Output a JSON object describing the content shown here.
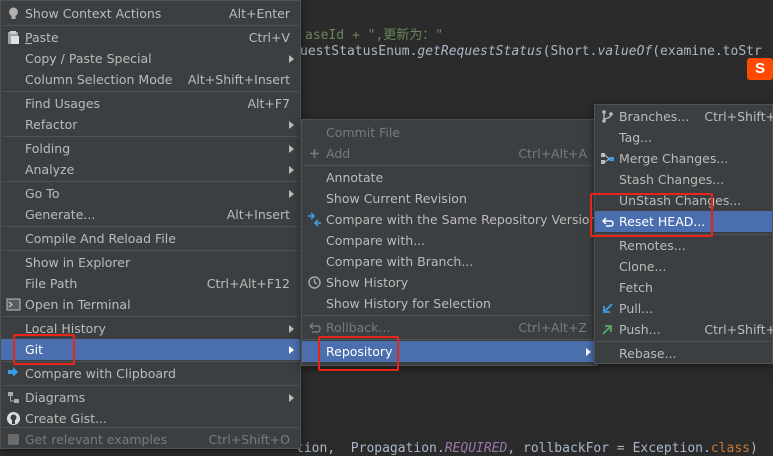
{
  "editor": {
    "line1": "aseId + \",更新为：\"",
    "line2a": "uestStatusEnum.",
    "line2b": "getRequestStatus",
    "line2c": "(Short.",
    "line2d": "valueOf",
    "line2e": "(examine.toStr",
    "line3a": "tion,  Propagation.",
    "line3b": "REQUIRED",
    "line3c": ", rollbackFor = Exception.",
    "line3d": "class",
    "line3e": ")"
  },
  "main_menu": {
    "items": [
      {
        "label": "Show Context Actions",
        "shortcut": "Alt+Enter",
        "icon": "bulb-icon"
      },
      {
        "label": "Paste",
        "shortcut": "Ctrl+V",
        "icon": "paste-icon"
      },
      {
        "label": "Copy / Paste Special",
        "shortcut": "",
        "submenu": true
      },
      {
        "label": "Column Selection Mode",
        "shortcut": "Alt+Shift+Insert"
      },
      {
        "label": "Find Usages",
        "shortcut": "Alt+F7"
      },
      {
        "label": "Refactor",
        "shortcut": "",
        "submenu": true
      },
      {
        "label": "Folding",
        "shortcut": "",
        "submenu": true
      },
      {
        "label": "Analyze",
        "shortcut": "",
        "submenu": true
      },
      {
        "label": "Go To",
        "shortcut": "",
        "submenu": true
      },
      {
        "label": "Generate...",
        "shortcut": "Alt+Insert"
      },
      {
        "label": "Compile And Reload File",
        "shortcut": ""
      },
      {
        "label": "Show in Explorer",
        "shortcut": ""
      },
      {
        "label": "File Path",
        "shortcut": "Ctrl+Alt+F12"
      },
      {
        "label": "Open in Terminal",
        "shortcut": "",
        "icon": "terminal-icon"
      },
      {
        "label": "Local History",
        "shortcut": "",
        "submenu": true
      },
      {
        "label": "Git",
        "shortcut": "",
        "submenu": true,
        "selected": true
      },
      {
        "label": "Compare with Clipboard",
        "shortcut": "",
        "icon": "compare-icon"
      },
      {
        "label": "Diagrams",
        "shortcut": "",
        "submenu": true,
        "icon": "diagram-icon"
      },
      {
        "label": "Create Gist...",
        "shortcut": "",
        "icon": "github-icon"
      },
      {
        "label": "Get relevant examples",
        "shortcut": "Ctrl+Shift+O",
        "disabled": true,
        "icon": "examples-icon"
      }
    ]
  },
  "git_menu": {
    "items": [
      {
        "label": "Commit File",
        "shortcut": "",
        "disabled": true
      },
      {
        "label": "Add",
        "shortcut": "Ctrl+Alt+A",
        "disabled": true,
        "icon": "plus-icon"
      },
      {
        "label": "Annotate",
        "shortcut": ""
      },
      {
        "label": "Show Current Revision",
        "shortcut": ""
      },
      {
        "label": "Compare with the Same Repository Version",
        "shortcut": "",
        "icon": "compare-arrows-icon"
      },
      {
        "label": "Compare with...",
        "shortcut": ""
      },
      {
        "label": "Compare with Branch...",
        "shortcut": ""
      },
      {
        "label": "Show History",
        "shortcut": "",
        "icon": "history-icon"
      },
      {
        "label": "Show History for Selection",
        "shortcut": ""
      },
      {
        "label": "Rollback...",
        "shortcut": "Ctrl+Alt+Z",
        "disabled": true,
        "icon": "rollback-icon"
      },
      {
        "label": "Repository",
        "shortcut": "",
        "submenu": true,
        "selected": true
      }
    ]
  },
  "repo_menu": {
    "items": [
      {
        "label": "Branches...",
        "shortcut": "Ctrl+Shift+",
        "icon": "branch-icon"
      },
      {
        "label": "Tag...",
        "shortcut": ""
      },
      {
        "label": "Merge Changes...",
        "shortcut": "",
        "icon": "merge-icon"
      },
      {
        "label": "Stash Changes...",
        "shortcut": ""
      },
      {
        "label": "UnStash Changes...",
        "shortcut": ""
      },
      {
        "label": "Reset HEAD...",
        "shortcut": "",
        "selected": true,
        "icon": "reset-icon"
      },
      {
        "label": "Remotes...",
        "shortcut": ""
      },
      {
        "label": "Clone...",
        "shortcut": ""
      },
      {
        "label": "Fetch",
        "shortcut": ""
      },
      {
        "label": "Pull...",
        "shortcut": "",
        "icon": "pull-icon"
      },
      {
        "label": "Push...",
        "shortcut": "Ctrl+Shift+",
        "icon": "push-icon"
      },
      {
        "label": "Rebase...",
        "shortcut": ""
      }
    ]
  },
  "colors": {
    "selection": "#4b6eaf",
    "menu_bg": "#3c3f41",
    "highlight_box": "#e8251a",
    "editor_bg": "#2b2b2b"
  },
  "watermark_logo": "S"
}
